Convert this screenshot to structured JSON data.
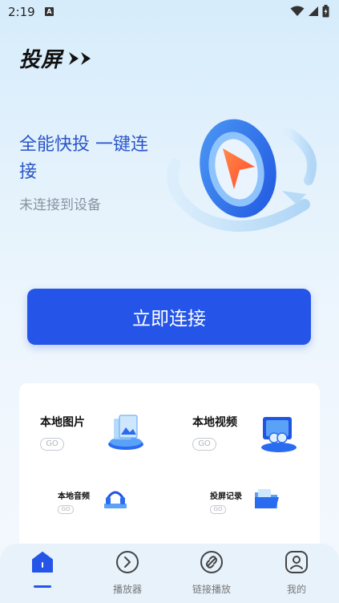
{
  "status_bar": {
    "time": "2:19",
    "notification_icon": "A",
    "icons": [
      "wifi-icon",
      "signal-icon",
      "battery-icon"
    ]
  },
  "header": {
    "logo_text": "投屏",
    "logo_arrows": "double-chevron-right-icon"
  },
  "hero": {
    "title": "全能快投 一键连接",
    "status": "未连接到设备",
    "illustration": "cast-target-illustration"
  },
  "connect_button": {
    "label": "立即连接"
  },
  "features": [
    {
      "title": "本地图片",
      "badge": "GO",
      "icon": "photo-stack-icon"
    },
    {
      "title": "本地视频",
      "badge": "GO",
      "icon": "video-screen-icon"
    },
    {
      "title": "本地音频",
      "badge": "GO",
      "icon": "headphones-icon"
    },
    {
      "title": "投屏记录",
      "badge": "GO",
      "icon": "folder-icon"
    }
  ],
  "bottom_nav": {
    "items": [
      {
        "label": "",
        "icon": "home-icon",
        "active": true
      },
      {
        "label": "播放器",
        "icon": "play-circle-icon",
        "active": false
      },
      {
        "label": "链接播放",
        "icon": "link-icon",
        "active": false
      },
      {
        "label": "我的",
        "icon": "profile-icon",
        "active": false
      }
    ]
  },
  "colors": {
    "accent": "#2455e8",
    "hero_title": "#2a55c8",
    "muted": "#8a93a0"
  }
}
